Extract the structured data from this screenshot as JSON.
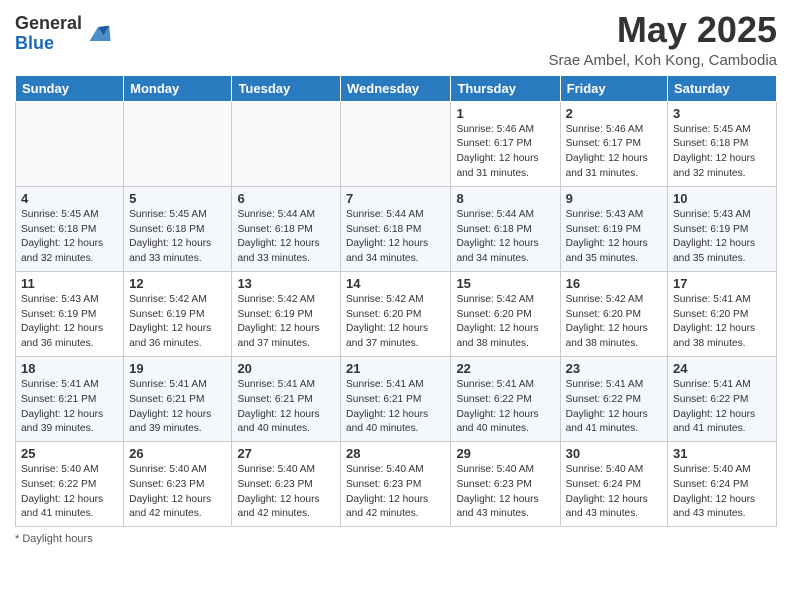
{
  "logo": {
    "general": "General",
    "blue": "Blue"
  },
  "title": "May 2025",
  "location": "Srae Ambel, Koh Kong, Cambodia",
  "days_of_week": [
    "Sunday",
    "Monday",
    "Tuesday",
    "Wednesday",
    "Thursday",
    "Friday",
    "Saturday"
  ],
  "weeks": [
    [
      {
        "num": "",
        "info": ""
      },
      {
        "num": "",
        "info": ""
      },
      {
        "num": "",
        "info": ""
      },
      {
        "num": "",
        "info": ""
      },
      {
        "num": "1",
        "info": "Sunrise: 5:46 AM\nSunset: 6:17 PM\nDaylight: 12 hours\nand 31 minutes."
      },
      {
        "num": "2",
        "info": "Sunrise: 5:46 AM\nSunset: 6:17 PM\nDaylight: 12 hours\nand 31 minutes."
      },
      {
        "num": "3",
        "info": "Sunrise: 5:45 AM\nSunset: 6:18 PM\nDaylight: 12 hours\nand 32 minutes."
      }
    ],
    [
      {
        "num": "4",
        "info": "Sunrise: 5:45 AM\nSunset: 6:18 PM\nDaylight: 12 hours\nand 32 minutes."
      },
      {
        "num": "5",
        "info": "Sunrise: 5:45 AM\nSunset: 6:18 PM\nDaylight: 12 hours\nand 33 minutes."
      },
      {
        "num": "6",
        "info": "Sunrise: 5:44 AM\nSunset: 6:18 PM\nDaylight: 12 hours\nand 33 minutes."
      },
      {
        "num": "7",
        "info": "Sunrise: 5:44 AM\nSunset: 6:18 PM\nDaylight: 12 hours\nand 34 minutes."
      },
      {
        "num": "8",
        "info": "Sunrise: 5:44 AM\nSunset: 6:18 PM\nDaylight: 12 hours\nand 34 minutes."
      },
      {
        "num": "9",
        "info": "Sunrise: 5:43 AM\nSunset: 6:19 PM\nDaylight: 12 hours\nand 35 minutes."
      },
      {
        "num": "10",
        "info": "Sunrise: 5:43 AM\nSunset: 6:19 PM\nDaylight: 12 hours\nand 35 minutes."
      }
    ],
    [
      {
        "num": "11",
        "info": "Sunrise: 5:43 AM\nSunset: 6:19 PM\nDaylight: 12 hours\nand 36 minutes."
      },
      {
        "num": "12",
        "info": "Sunrise: 5:42 AM\nSunset: 6:19 PM\nDaylight: 12 hours\nand 36 minutes."
      },
      {
        "num": "13",
        "info": "Sunrise: 5:42 AM\nSunset: 6:19 PM\nDaylight: 12 hours\nand 37 minutes."
      },
      {
        "num": "14",
        "info": "Sunrise: 5:42 AM\nSunset: 6:20 PM\nDaylight: 12 hours\nand 37 minutes."
      },
      {
        "num": "15",
        "info": "Sunrise: 5:42 AM\nSunset: 6:20 PM\nDaylight: 12 hours\nand 38 minutes."
      },
      {
        "num": "16",
        "info": "Sunrise: 5:42 AM\nSunset: 6:20 PM\nDaylight: 12 hours\nand 38 minutes."
      },
      {
        "num": "17",
        "info": "Sunrise: 5:41 AM\nSunset: 6:20 PM\nDaylight: 12 hours\nand 38 minutes."
      }
    ],
    [
      {
        "num": "18",
        "info": "Sunrise: 5:41 AM\nSunset: 6:21 PM\nDaylight: 12 hours\nand 39 minutes."
      },
      {
        "num": "19",
        "info": "Sunrise: 5:41 AM\nSunset: 6:21 PM\nDaylight: 12 hours\nand 39 minutes."
      },
      {
        "num": "20",
        "info": "Sunrise: 5:41 AM\nSunset: 6:21 PM\nDaylight: 12 hours\nand 40 minutes."
      },
      {
        "num": "21",
        "info": "Sunrise: 5:41 AM\nSunset: 6:21 PM\nDaylight: 12 hours\nand 40 minutes."
      },
      {
        "num": "22",
        "info": "Sunrise: 5:41 AM\nSunset: 6:22 PM\nDaylight: 12 hours\nand 40 minutes."
      },
      {
        "num": "23",
        "info": "Sunrise: 5:41 AM\nSunset: 6:22 PM\nDaylight: 12 hours\nand 41 minutes."
      },
      {
        "num": "24",
        "info": "Sunrise: 5:41 AM\nSunset: 6:22 PM\nDaylight: 12 hours\nand 41 minutes."
      }
    ],
    [
      {
        "num": "25",
        "info": "Sunrise: 5:40 AM\nSunset: 6:22 PM\nDaylight: 12 hours\nand 41 minutes."
      },
      {
        "num": "26",
        "info": "Sunrise: 5:40 AM\nSunset: 6:23 PM\nDaylight: 12 hours\nand 42 minutes."
      },
      {
        "num": "27",
        "info": "Sunrise: 5:40 AM\nSunset: 6:23 PM\nDaylight: 12 hours\nand 42 minutes."
      },
      {
        "num": "28",
        "info": "Sunrise: 5:40 AM\nSunset: 6:23 PM\nDaylight: 12 hours\nand 42 minutes."
      },
      {
        "num": "29",
        "info": "Sunrise: 5:40 AM\nSunset: 6:23 PM\nDaylight: 12 hours\nand 43 minutes."
      },
      {
        "num": "30",
        "info": "Sunrise: 5:40 AM\nSunset: 6:24 PM\nDaylight: 12 hours\nand 43 minutes."
      },
      {
        "num": "31",
        "info": "Sunrise: 5:40 AM\nSunset: 6:24 PM\nDaylight: 12 hours\nand 43 minutes."
      }
    ]
  ],
  "footer": "Daylight hours"
}
